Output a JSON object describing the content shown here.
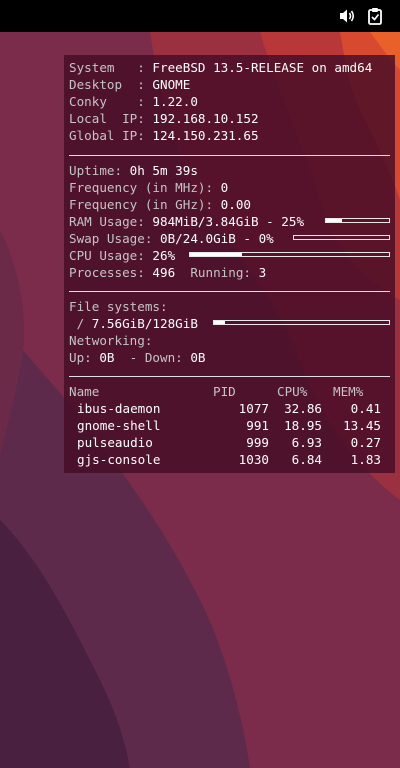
{
  "topbar": {
    "volume_icon": "speaker-volume-icon",
    "clipboard_icon": "clipboard-icon"
  },
  "conky": {
    "system_label": "System   : ",
    "system_value": "FreeBSD 13.5-RELEASE on amd64",
    "desktop_label": "Desktop  : ",
    "desktop_value": "GNOME",
    "conky_label": "Conky    : ",
    "conky_value": "1.22.0",
    "local_ip_label": "Local  IP: ",
    "local_ip_value": "192.168.10.152",
    "global_ip_label": "Global IP: ",
    "global_ip_value": "124.150.231.65",
    "uptime_label": "Uptime: ",
    "uptime_value": "0h 5m 39s",
    "freq_mhz_label": "Frequency (in MHz): ",
    "freq_mhz_value": "0",
    "freq_ghz_label": "Frequency (in GHz): ",
    "freq_ghz_value": "0.00",
    "ram_label": "RAM Usage: ",
    "ram_value": "984MiB/3.84GiB - 25%",
    "ram_percent": 25,
    "swap_label": "Swap Usage: ",
    "swap_value": "0B/24.0GiB - 0%",
    "swap_percent": 0,
    "cpu_label": "CPU Usage: ",
    "cpu_value": "26%",
    "cpu_percent": 26,
    "processes_label": "Processes: ",
    "processes_value": "496",
    "running_label": "  Running: ",
    "running_value": "3",
    "fs_label": "File systems:",
    "fs_root_label": " / ",
    "fs_root_value": "7.56GiB/128GiB",
    "fs_root_percent": 6,
    "networking_label": "Networking:",
    "up_label": "Up: ",
    "up_value": "0B",
    "down_label": "  - Down: ",
    "down_value": "0B",
    "proc_headers": {
      "name": "Name",
      "pid": "PID",
      "cpu": "CPU%",
      "mem": "MEM%"
    },
    "processes": [
      {
        "name": "ibus-daemon",
        "pid": "1077",
        "cpu": "32.86",
        "mem": "0.41"
      },
      {
        "name": "gnome-shell",
        "pid": "991",
        "cpu": "18.95",
        "mem": "13.45"
      },
      {
        "name": "pulseaudio",
        "pid": "999",
        "cpu": "6.93",
        "mem": "0.27"
      },
      {
        "name": "gjs-console",
        "pid": "1030",
        "cpu": "6.84",
        "mem": "1.83"
      }
    ]
  }
}
